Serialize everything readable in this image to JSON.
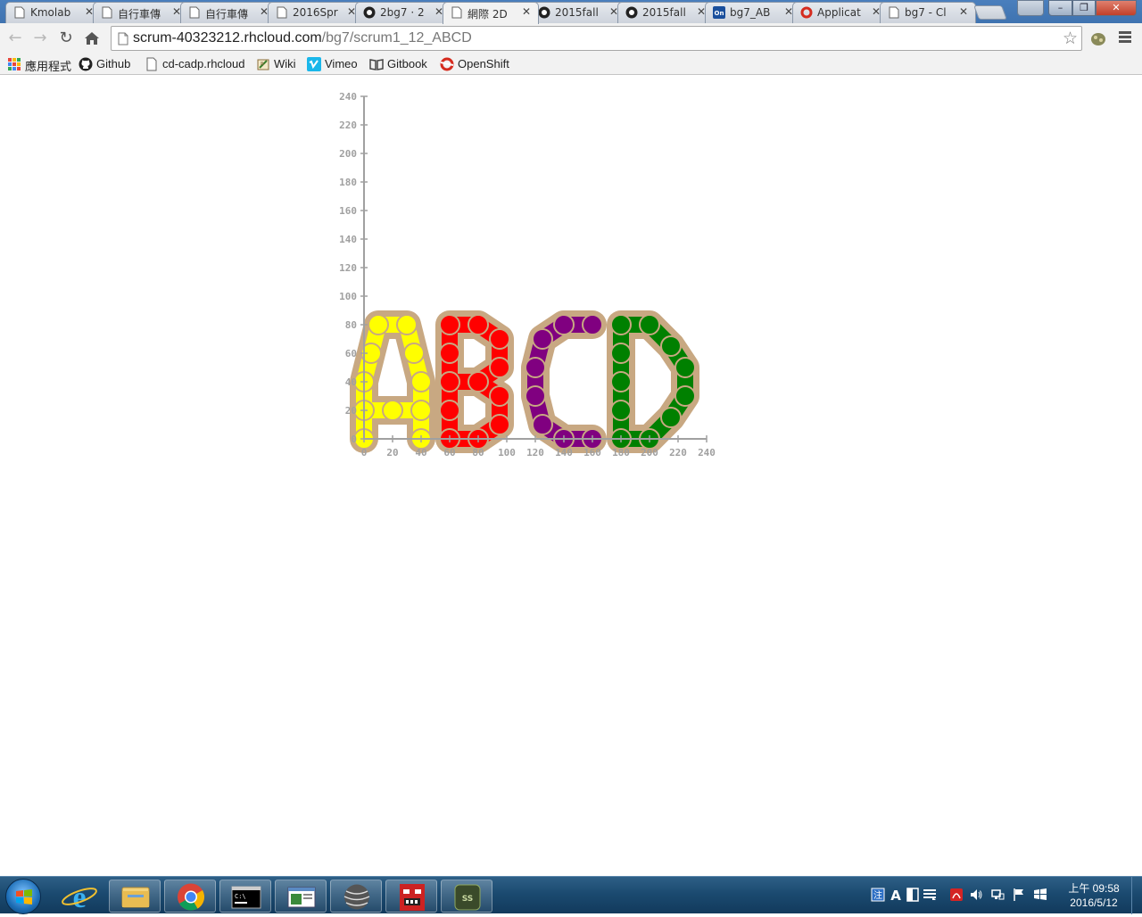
{
  "tabs": [
    {
      "label": "Kmolab",
      "icon": "page-icon",
      "active": false
    },
    {
      "label": "自行車傳",
      "icon": "page-icon",
      "active": false
    },
    {
      "label": "自行車傳",
      "icon": "page-icon",
      "active": false
    },
    {
      "label": "2016Spr",
      "icon": "page-icon",
      "active": false
    },
    {
      "label": "2bg7 · 2",
      "icon": "github-icon",
      "active": false
    },
    {
      "label": "網際 2D",
      "icon": "page-icon",
      "active": true
    },
    {
      "label": "2015fall",
      "icon": "github-icon",
      "active": false
    },
    {
      "label": "2015fall",
      "icon": "github-icon",
      "active": false
    },
    {
      "label": "bg7_AB",
      "icon": "onshape-icon",
      "active": false
    },
    {
      "label": "Applicat",
      "icon": "openshift-icon",
      "active": false
    },
    {
      "label": "bg7 - Cl",
      "icon": "page-icon",
      "active": false
    }
  ],
  "address_bar": {
    "domain": "scrum-40323212.rhcloud.com",
    "path": "/bg7/scrum1_12_ABCD"
  },
  "bookmarks": [
    {
      "label": "應用程式",
      "icon": "apps-icon"
    },
    {
      "label": "Github",
      "icon": "github-icon"
    },
    {
      "label": "cd-cadp.rhcloud",
      "icon": "page-icon"
    },
    {
      "label": "Wiki",
      "icon": "wiki-icon"
    },
    {
      "label": "Vimeo",
      "icon": "vimeo-icon"
    },
    {
      "label": "Gitbook",
      "icon": "gitbook-icon"
    },
    {
      "label": "OpenShift",
      "icon": "openshift-icon"
    }
  ],
  "canvas": {
    "x_ticks": [
      "0",
      "20",
      "40",
      "60",
      "80",
      "100",
      "120",
      "140",
      "160",
      "180",
      "200",
      "220",
      "240"
    ],
    "y_ticks": [
      "0",
      "20",
      "40",
      "60",
      "80",
      "100",
      "120",
      "140",
      "160",
      "180",
      "200",
      "220",
      "240"
    ],
    "axis_range": [
      0,
      240
    ],
    "outline_color": "#c8a882",
    "letters": [
      {
        "letter": "A",
        "color": "#ffff00",
        "points": [
          [
            0,
            0
          ],
          [
            0,
            20
          ],
          [
            0,
            40
          ],
          [
            5,
            60
          ],
          [
            10,
            80
          ],
          [
            30,
            80
          ],
          [
            35,
            60
          ],
          [
            40,
            40
          ],
          [
            40,
            20
          ],
          [
            40,
            0
          ]
        ],
        "crossbar": [
          [
            0,
            20
          ],
          [
            20,
            20
          ],
          [
            40,
            20
          ]
        ]
      },
      {
        "letter": "B",
        "color": "#ff0000",
        "points": [
          [
            60,
            0
          ],
          [
            60,
            20
          ],
          [
            60,
            40
          ],
          [
            60,
            60
          ],
          [
            60,
            80
          ],
          [
            80,
            80
          ],
          [
            95,
            70
          ],
          [
            95,
            50
          ],
          [
            80,
            40
          ],
          [
            95,
            30
          ],
          [
            95,
            10
          ],
          [
            80,
            0
          ],
          [
            60,
            0
          ]
        ],
        "crossbar": [
          [
            60,
            40
          ],
          [
            80,
            40
          ]
        ]
      },
      {
        "letter": "C",
        "color": "#800080",
        "points": [
          [
            160,
            80
          ],
          [
            140,
            80
          ],
          [
            125,
            70
          ],
          [
            120,
            50
          ],
          [
            120,
            30
          ],
          [
            125,
            10
          ],
          [
            140,
            0
          ],
          [
            160,
            0
          ]
        ],
        "crossbar": []
      },
      {
        "letter": "D",
        "color": "#008000",
        "points": [
          [
            180,
            0
          ],
          [
            180,
            20
          ],
          [
            180,
            40
          ],
          [
            180,
            60
          ],
          [
            180,
            80
          ],
          [
            200,
            80
          ],
          [
            215,
            65
          ],
          [
            225,
            50
          ],
          [
            225,
            30
          ],
          [
            215,
            15
          ],
          [
            200,
            0
          ],
          [
            180,
            0
          ]
        ],
        "crossbar": []
      }
    ]
  },
  "taskbar": {
    "buttons": [
      "ie-icon",
      "explorer-icon",
      "chrome-icon",
      "cmd-icon",
      "window-icon",
      "sphere-icon",
      "game-icon",
      "ss-icon"
    ],
    "clock_time": "上午 09:58",
    "clock_date": "2016/5/12"
  }
}
